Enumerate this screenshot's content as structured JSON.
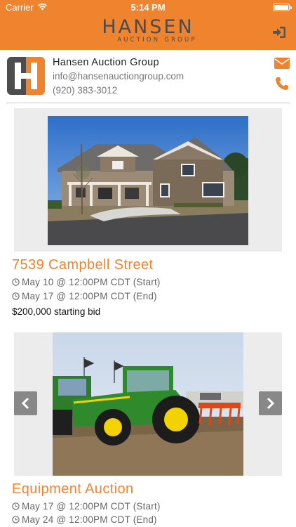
{
  "status_bar": {
    "carrier": "Carrier",
    "time": "5:14 PM"
  },
  "header": {
    "logo_word": "HANSEN",
    "logo_sub": "AUCTION GROUP",
    "login_icon": "sign-in-icon",
    "bg_color": "#f0832e"
  },
  "agency": {
    "name": "Hansen Auction Group",
    "email": "info@hansenauctiongroup.com",
    "phone": "(920) 383-3012",
    "mail_icon": "envelope-icon",
    "phone_icon": "phone-icon"
  },
  "listings": [
    {
      "title": "7539 Campbell Street",
      "start": "May 10 @ 12:00PM CDT (Start)",
      "end": "May 17 @ 12:00PM CDT (End)",
      "bid": "$200,000 starting bid"
    },
    {
      "title": "Equipment Auction",
      "start": "May 17 @ 12:00PM CDT (Start)",
      "end": "May 24 @ 12:00PM CDT (End)",
      "prev_icon": "chevron-left-icon",
      "next_icon": "chevron-right-icon"
    }
  ]
}
